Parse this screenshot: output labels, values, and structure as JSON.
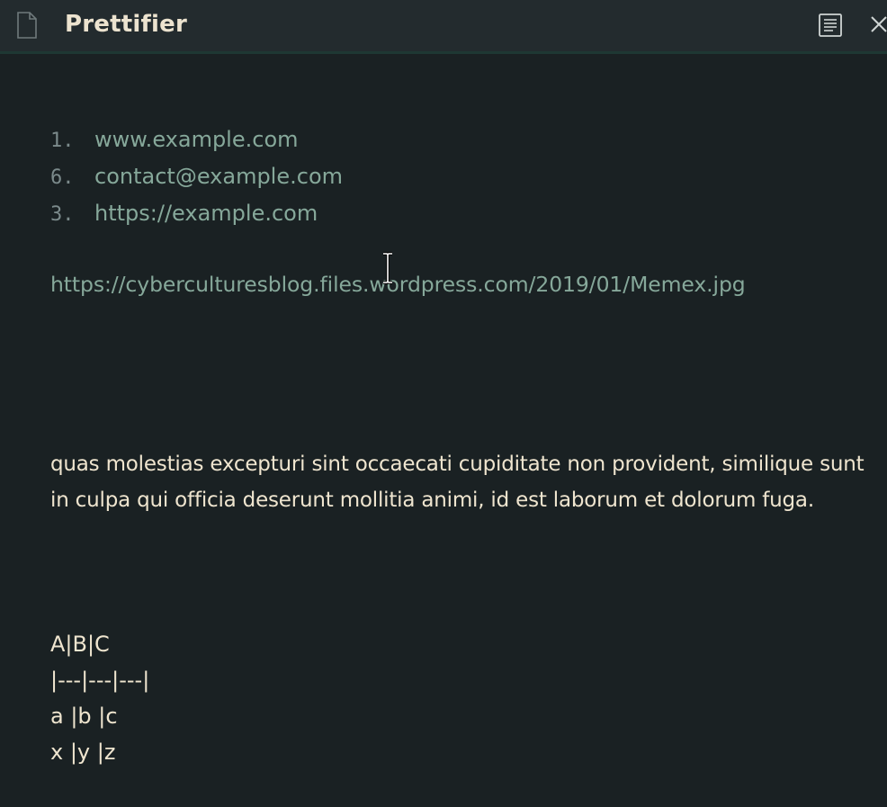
{
  "titlebar": {
    "title": "Prettifier",
    "file_icon": "file-icon",
    "reading_mode_icon": "reading-view-icon",
    "close_icon": "close-icon"
  },
  "list": [
    {
      "marker": "1.",
      "text": "www.example.com"
    },
    {
      "marker": "6.",
      "text": "contact@example.com"
    },
    {
      "marker": "3.",
      "text": "https://example.com"
    }
  ],
  "url_line": "https://cyberculturesblog.files.wordpress.com/2019/01/Memex.jpg",
  "paragraph": "quas molestias excepturi sint occaecati cupiditate non provident, similique sunt in culpa qui officia deserunt mollitia animi, id est laborum et dolorum fuga.",
  "table_lines": [
    "A|B|C",
    "|---|---|---|",
    "a |b |c",
    "x |y |z"
  ],
  "colors": {
    "background": "#1a2123",
    "titlebar": "#232b2e",
    "link": "#86a89a",
    "text": "#efe5cf",
    "list_marker": "#7b8a8b"
  }
}
